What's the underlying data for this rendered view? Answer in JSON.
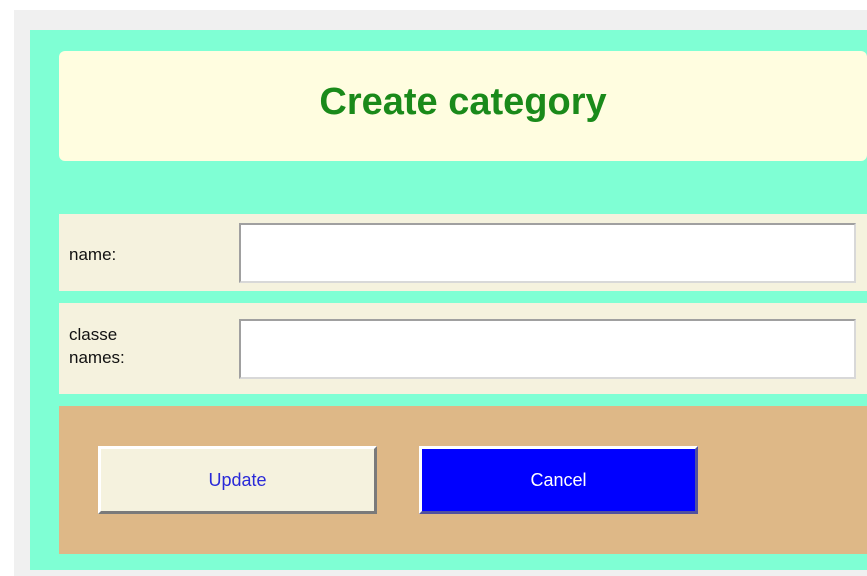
{
  "header": {
    "title": "Create category"
  },
  "form": {
    "name_label": "name:",
    "name_value": "",
    "classes_label": "classe names:",
    "classes_value": ""
  },
  "actions": {
    "update_label": "Update",
    "cancel_label": "Cancel"
  },
  "colors": {
    "panel_background": "#7fffd4",
    "header_background": "#fffde0",
    "title_color": "#1a8a1a",
    "row_background": "#f5f2de",
    "actions_background": "#deb887",
    "cancel_background": "#0000ff",
    "update_text_color": "#2a2ad8"
  }
}
